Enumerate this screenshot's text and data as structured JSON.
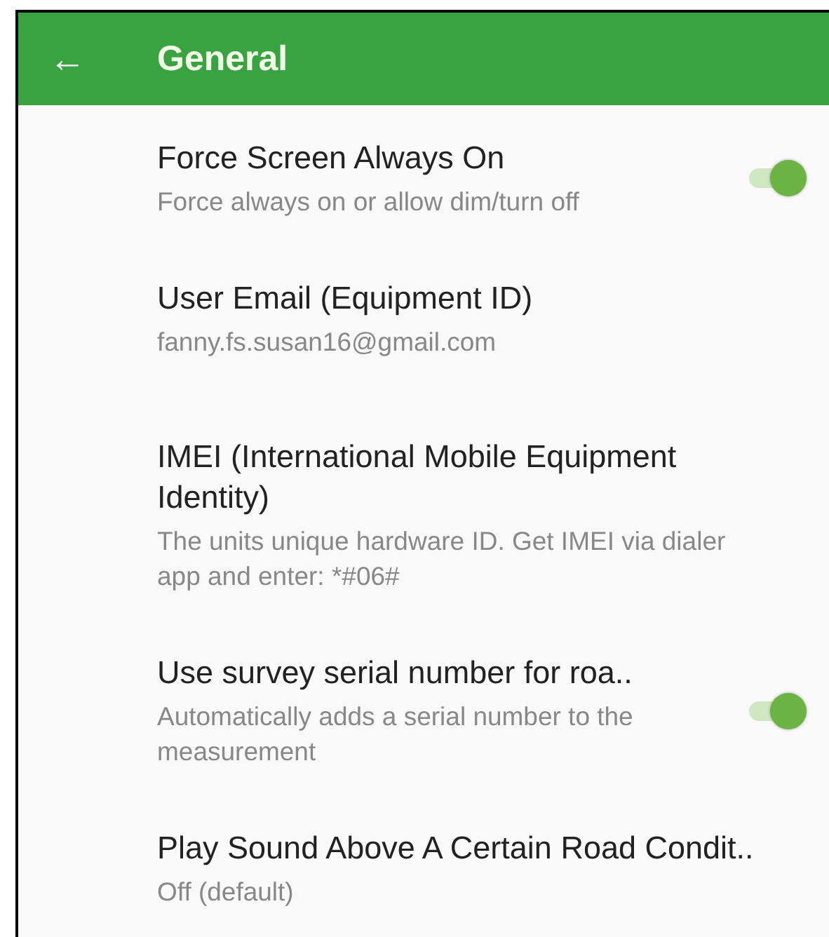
{
  "app_bar": {
    "back_icon": "←",
    "title": "General"
  },
  "settings": [
    {
      "kind": "switch",
      "title": "Force Screen Always On",
      "summary": "Force always on or allow dim/turn off",
      "on": true
    },
    {
      "kind": "text",
      "title": "User Email (Equipment ID)",
      "summary": "fanny.fs.susan16@gmail.com"
    },
    {
      "kind": "text",
      "title": "IMEI (International Mobile Equipment Identity)",
      "summary": "The units unique hardware ID. Get IMEI via dialer app and enter: *#06#"
    },
    {
      "kind": "switch",
      "title": "Use survey serial number for roa..",
      "summary": "Automatically adds a serial number to the measurement",
      "on": true
    },
    {
      "kind": "text",
      "title": "Play Sound Above A Certain Road Condit..",
      "summary": "Off (default)"
    }
  ]
}
